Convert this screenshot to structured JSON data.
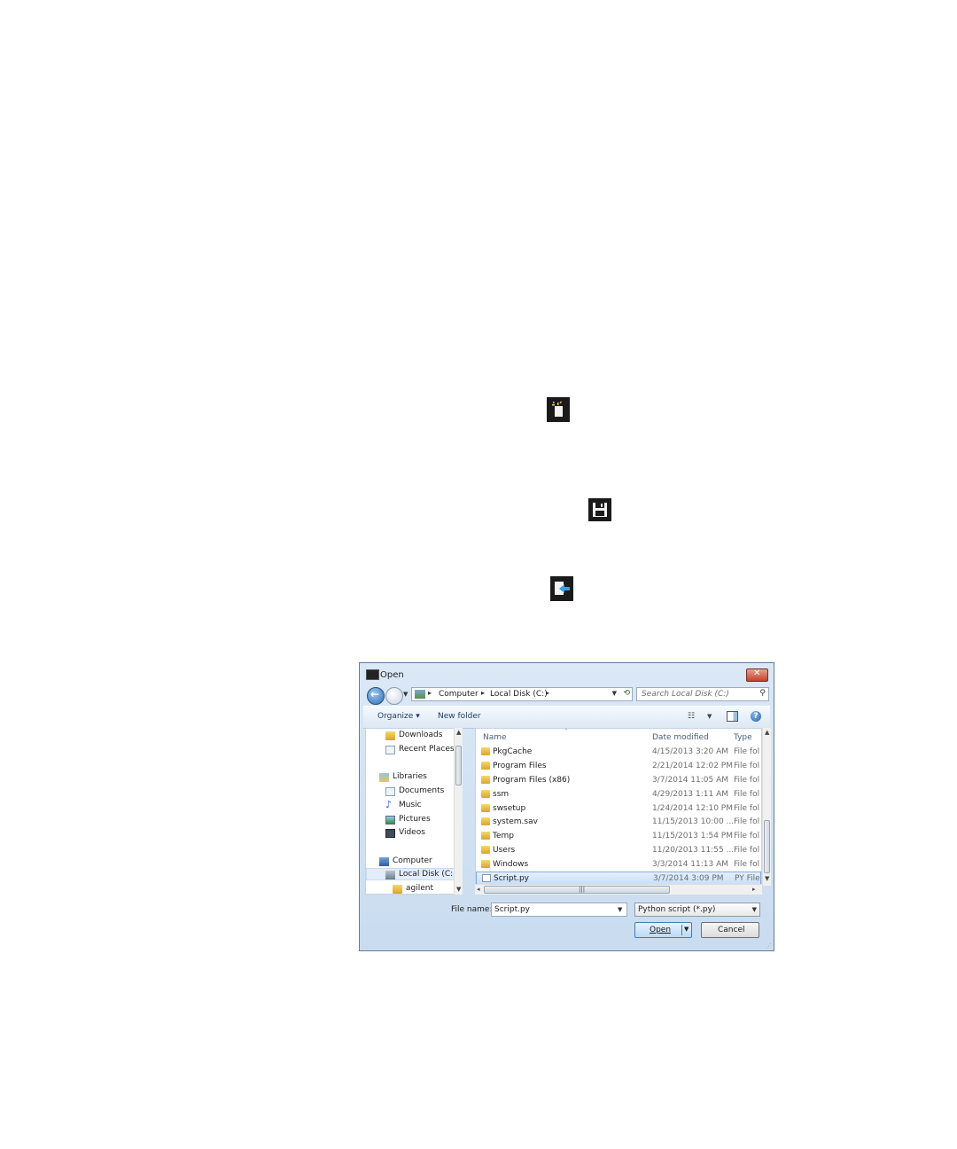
{
  "toolbar_icons": {
    "new_icon": "new-script-icon",
    "save_icon": "save-icon",
    "open_icon": "open-icon"
  },
  "dialog": {
    "title": "Open",
    "address": {
      "crumbs": [
        "Computer",
        "Local Disk (C:)"
      ]
    },
    "search_placeholder": "Search Local Disk (C:)",
    "toolbar": {
      "organize": "Organize",
      "new_folder": "New folder"
    },
    "nav": {
      "items": [
        {
          "label": "Downloads"
        },
        {
          "label": "Recent Places"
        },
        {
          "label": "Libraries"
        },
        {
          "label": "Documents"
        },
        {
          "label": "Music"
        },
        {
          "label": "Pictures"
        },
        {
          "label": "Videos"
        },
        {
          "label": "Computer"
        },
        {
          "label": "Local Disk (C:)"
        },
        {
          "label": "agilent"
        }
      ]
    },
    "columns": {
      "name": "Name",
      "date": "Date modified",
      "type": "Type"
    },
    "files": [
      {
        "name": "PkgCache",
        "date": "4/15/2013 3:20 AM",
        "type": "File fol"
      },
      {
        "name": "Program Files",
        "date": "2/21/2014 12:02 PM",
        "type": "File fol"
      },
      {
        "name": "Program Files (x86)",
        "date": "3/7/2014 11:05 AM",
        "type": "File fol"
      },
      {
        "name": "ssm",
        "date": "4/29/2013 1:11 AM",
        "type": "File fol"
      },
      {
        "name": "swsetup",
        "date": "1/24/2014 12:10 PM",
        "type": "File fol"
      },
      {
        "name": "system.sav",
        "date": "11/15/2013 10:00 ...",
        "type": "File fol"
      },
      {
        "name": "Temp",
        "date": "11/15/2013 1:54 PM",
        "type": "File fol"
      },
      {
        "name": "Users",
        "date": "11/20/2013 11:55 ...",
        "type": "File fol"
      },
      {
        "name": "Windows",
        "date": "3/3/2014 11:13 AM",
        "type": "File fol"
      },
      {
        "name": "Script.py",
        "date": "3/7/2014 3:09 PM",
        "type": "PY File"
      }
    ],
    "file_name_label": "File name:",
    "file_name_value": "Script.py",
    "file_type": "Python script (*.py)",
    "open_label": "Open",
    "cancel_label": "Cancel"
  }
}
